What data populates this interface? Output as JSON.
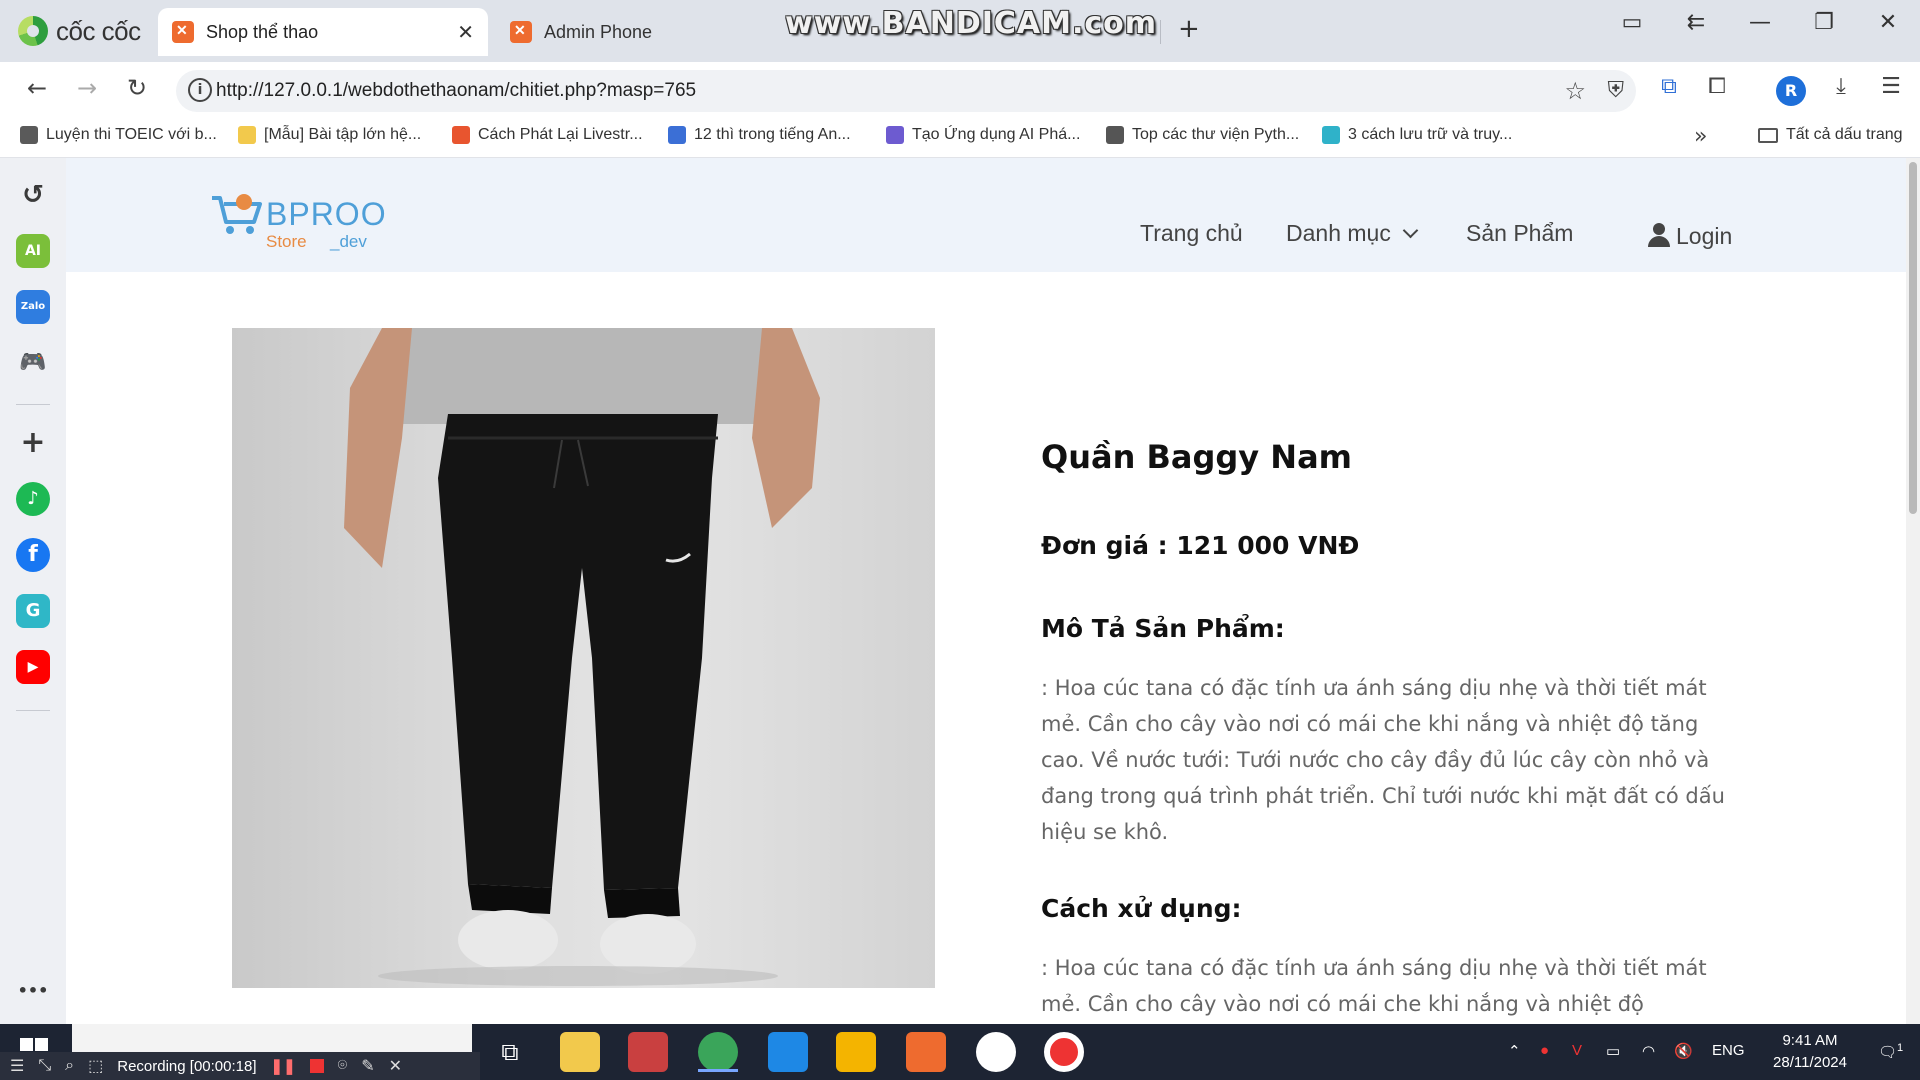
{
  "browser": {
    "brand": "cốc cốc",
    "tabs": [
      {
        "title": "Shop thể thao",
        "active": true
      },
      {
        "title": "Admin Phone",
        "active": false
      }
    ],
    "watermark": "www.BANDICAM.com",
    "url": "http://127.0.0.1/webdothethaonam/chitiet.php?masp=765",
    "profile_initial": "R",
    "bookmarks": [
      {
        "label": "Luyện thi TOEIC với b...",
        "color": "#5a5a5a"
      },
      {
        "label": "[Mẫu] Bài tập lớn hệ...",
        "color": "#f2c94c"
      },
      {
        "label": "Cách Phát Lại Livestr...",
        "color": "#e8552f"
      },
      {
        "label": "12 thì trong tiếng An...",
        "color": "#3b6fd6"
      },
      {
        "label": "Tạo Ứng dụng AI Phá...",
        "color": "#6d5bd0"
      },
      {
        "label": "Top các thư viện Pyth...",
        "color": "#555555"
      },
      {
        "label": "3 cách lưu trữ và truy...",
        "color": "#2fb2c9"
      }
    ],
    "all_bookmarks": "Tất cả dấu trang",
    "side_rail": [
      {
        "name": "history-icon",
        "glyph": "↻",
        "color": "#3a3a3a"
      },
      {
        "name": "ai-icon",
        "glyph": "AI",
        "color": "#7bbf3a"
      },
      {
        "name": "zalo-icon",
        "glyph": "Zalo",
        "color": "#2f7de0"
      },
      {
        "name": "game-icon",
        "glyph": "🎮",
        "color": "#3aa55a"
      },
      {
        "name": "add-icon",
        "glyph": "+",
        "color": "#3a3a3a"
      },
      {
        "name": "spotify-icon",
        "glyph": "♪",
        "color": "#1db954"
      },
      {
        "name": "facebook-icon",
        "glyph": "f",
        "color": "#1877f2"
      },
      {
        "name": "g-icon",
        "glyph": "G",
        "color": "#2fb7c7"
      },
      {
        "name": "youtube-icon",
        "glyph": "▶",
        "color": "#ff0000"
      },
      {
        "name": "more-icon",
        "glyph": "•••",
        "color": "#3a3a3a"
      }
    ]
  },
  "site": {
    "logo": {
      "word": "BPROO",
      "sub1": "Store",
      "sub2": "_dev"
    },
    "nav": {
      "home": "Trang chủ",
      "category": "Danh mục",
      "products": "Sản Phẩm",
      "login": "Login"
    }
  },
  "product": {
    "name": "Quần Baggy Nam",
    "price": "Đơn giá : 121 000 VNĐ",
    "desc_heading": "Mô Tả Sản Phẩm:",
    "desc": ": Hoa cúc tana có đặc tính ưa ánh sáng dịu nhẹ và thời tiết mát mẻ. Cần cho cây vào nơi có mái che khi nắng và nhiệt độ tăng cao. Về nước tưới: Tưới nước cho cây đầy đủ lúc cây còn nhỏ và đang trong quá trình phát triển. Chỉ tưới nước khi mặt đất có dấu hiệu se khô.",
    "usage_heading": "Cách xử dụng:",
    "usage": ": Hoa cúc tana có đặc tính ưa ánh sáng dịu nhẹ và thời tiết mát mẻ. Cần cho cây vào nơi có mái che khi nắng và nhiệt độ"
  },
  "taskbar": {
    "language": "ENG",
    "time": "9:41 AM",
    "date": "28/11/2024",
    "notification_count": "1"
  },
  "recorder": {
    "status": "Recording [00:00:18]"
  }
}
